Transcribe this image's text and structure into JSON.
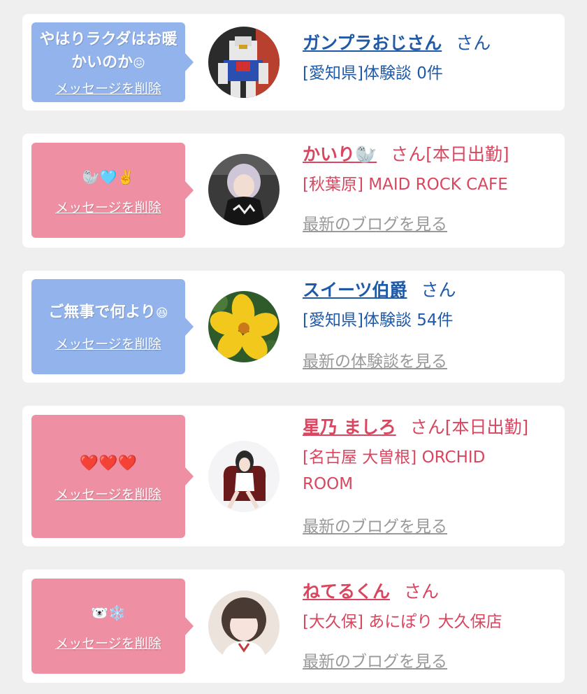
{
  "delete_label": "メッセージを削除",
  "san": "さん",
  "cards": [
    {
      "message": "やはりラクダはお暖かいのか",
      "message_emoji": "😖",
      "name": "ガンプラおじさん",
      "suffix": "",
      "sub": "[愛知県]体験談 0件",
      "link": ""
    },
    {
      "message": "",
      "message_emoji": "🦭🩵✌️",
      "name": "かいり🦭",
      "suffix": "[本日出勤]",
      "sub": "[秋葉原] MAID ROCK CAFE",
      "link": "最新のブログを見る"
    },
    {
      "message": "ご無事で何より",
      "message_emoji": "😆",
      "name": "スイーツ伯爵",
      "suffix": "",
      "sub": "[愛知県]体験談 54件",
      "link": "最新の体験談を見る"
    },
    {
      "message": "",
      "message_emoji": "❤️❤️❤️",
      "name": "星乃 ましろ",
      "suffix": "[本日出勤]",
      "sub": "[名古屋 大曽根] ORCHID ROOM",
      "link": "最新のブログを見る"
    },
    {
      "message": "",
      "message_emoji": "🐻‍❄️❄️",
      "name": "ねてるくん",
      "suffix": "",
      "sub": "[大久保] あにぽり 大久保店",
      "link": "最新のブログを見る"
    }
  ],
  "colors": {
    "blue_bubble": "#92b3ec",
    "pink_bubble": "#ef8fa3",
    "blue_text": "#1f5aa8",
    "pink_text": "#d8465f",
    "link_gray": "#999999",
    "background": "#efefef"
  }
}
